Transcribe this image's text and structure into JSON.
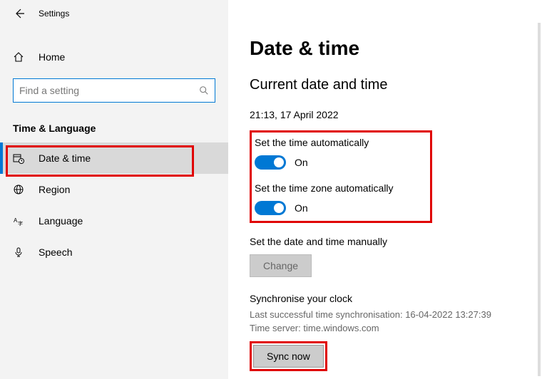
{
  "titlebar": {
    "title": "Settings"
  },
  "sidebar": {
    "home": "Home",
    "search_placeholder": "Find a setting",
    "section": "Time & Language",
    "items": [
      {
        "label": "Date & time"
      },
      {
        "label": "Region"
      },
      {
        "label": "Language"
      },
      {
        "label": "Speech"
      }
    ]
  },
  "main": {
    "heading": "Date & time",
    "subheading": "Current date and time",
    "current": "21:13, 17 April 2022",
    "auto_time": {
      "label": "Set the time automatically",
      "state": "On"
    },
    "auto_zone": {
      "label": "Set the time zone automatically",
      "state": "On"
    },
    "manual": {
      "label": "Set the date and time manually",
      "button": "Change"
    },
    "sync": {
      "title": "Synchronise your clock",
      "last": "Last successful time synchronisation: 16-04-2022 13:27:39",
      "server": "Time server: time.windows.com",
      "button": "Sync now"
    }
  }
}
